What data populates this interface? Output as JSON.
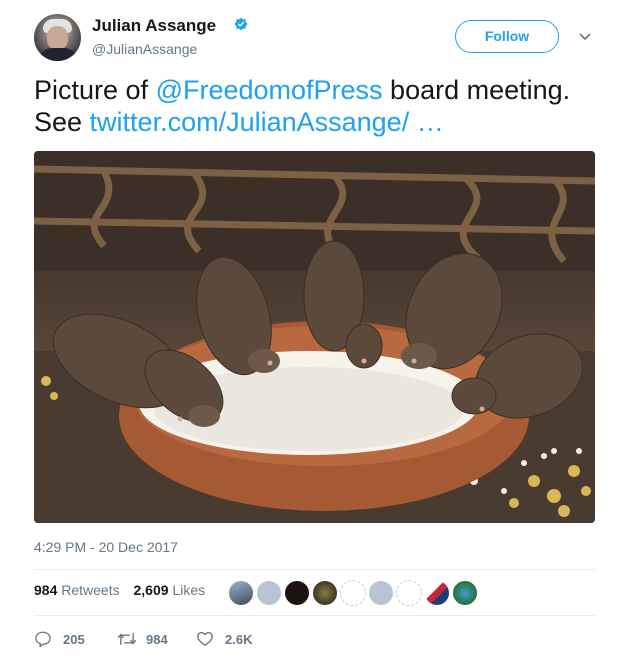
{
  "author": {
    "name": "Julian Assange",
    "handle": "@JulianAssange",
    "verified": true
  },
  "follow": {
    "label": "Follow"
  },
  "tweet": {
    "text_prefix": "Picture of ",
    "mention": "@FreedomofPress",
    "text_middle": " board meeting. See ",
    "link": "twitter.com/JulianAssange/ …"
  },
  "timestamp": "4:29 PM - 20 Dec 2017",
  "stats": {
    "retweets_count": "984",
    "retweets_label": "Retweets",
    "likes_count": "2,609",
    "likes_label": "Likes"
  },
  "actions": {
    "replies": "205",
    "retweets": "984",
    "likes": "2.6K"
  },
  "colors": {
    "accent": "#1da1f2",
    "muted": "#657786",
    "text": "#14171a"
  },
  "icons": [
    "verified-badge-icon",
    "chevron-down-icon",
    "reply-icon",
    "retweet-icon",
    "like-icon"
  ]
}
